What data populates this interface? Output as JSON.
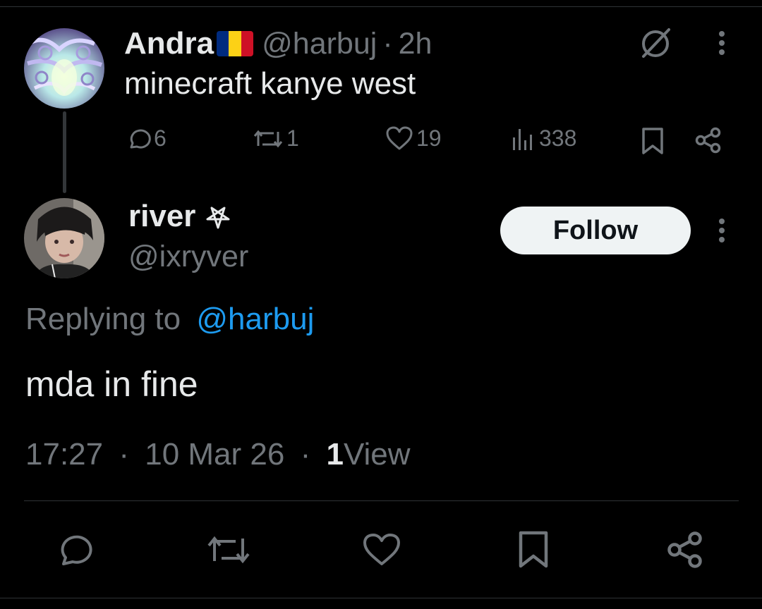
{
  "parent_post": {
    "author_name": "Andra",
    "flag_colors": [
      "#002B7F",
      "#FCD116",
      "#CE1126"
    ],
    "handle": "@harbuj",
    "separator": "·",
    "time": "2h",
    "text": "minecraft kanye west",
    "actions": {
      "replies": "6",
      "reposts": "1",
      "likes": "19",
      "views": "338"
    }
  },
  "reply_post": {
    "author_name": "river",
    "name_glyph": "pentagram-icon",
    "handle": "@ixryver",
    "follow_label": "Follow",
    "replying_prefix": "Replying to",
    "replying_handle": "@harbuj",
    "text": "mda in fine",
    "time": "17:27",
    "separator": "·",
    "date": "10 Mar 26",
    "views_count": "1",
    "views_label": "View"
  },
  "colors": {
    "background": "#000000",
    "primary_text": "#e7e9ea",
    "secondary_text": "#71767b",
    "link": "#1d9bf0",
    "button_bg": "#eff3f4"
  }
}
